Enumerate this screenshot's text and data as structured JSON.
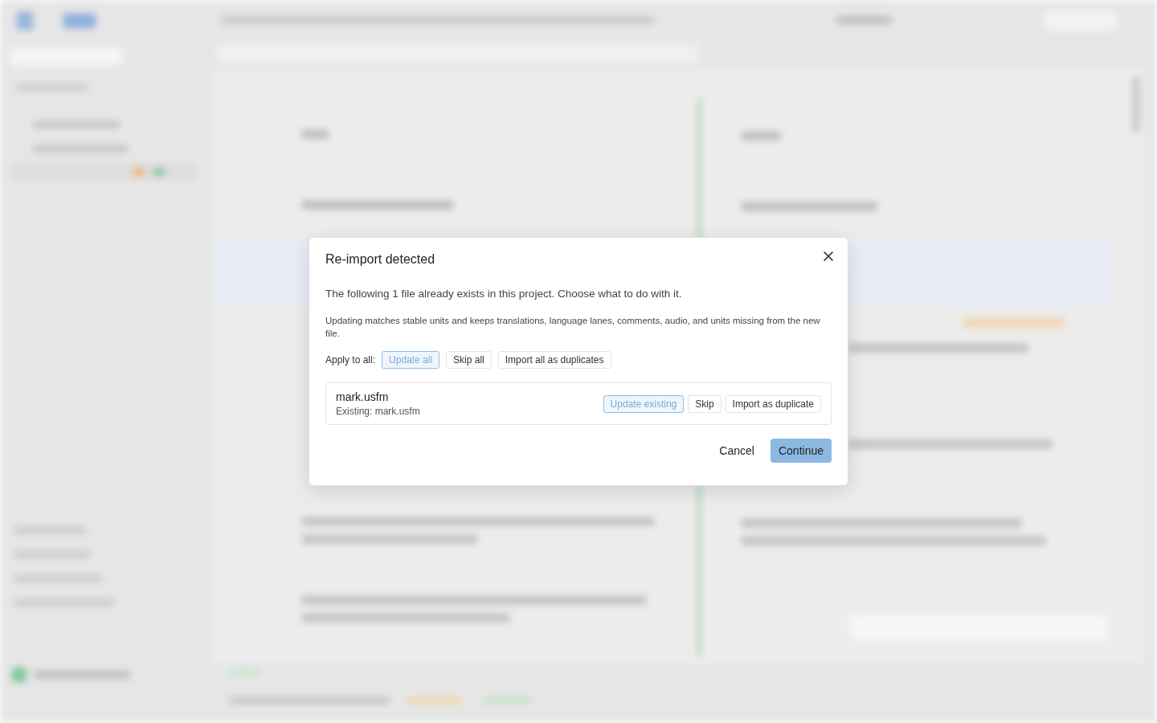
{
  "dialog": {
    "title": "Re-import detected",
    "intro": "The following 1 file already exists in this project. Choose what to do with it.",
    "note": "Updating matches stable units and keeps translations, language lanes, comments, audio, and units missing from the new file.",
    "apply_all": {
      "label": "Apply to all:",
      "options": [
        {
          "label": "Update all",
          "selected": true
        },
        {
          "label": "Skip all",
          "selected": false
        },
        {
          "label": "Import all as duplicates",
          "selected": false
        }
      ]
    },
    "files": [
      {
        "name": "mark.usfm",
        "existing": "Existing: mark.usfm",
        "options": [
          {
            "label": "Update existing",
            "selected": true
          },
          {
            "label": "Skip",
            "selected": false
          },
          {
            "label": "Import as duplicate",
            "selected": false
          }
        ]
      }
    ],
    "buttons": [
      {
        "label": "Cancel",
        "kind": "secondary"
      },
      {
        "label": "Continue",
        "kind": "primary"
      }
    ]
  }
}
